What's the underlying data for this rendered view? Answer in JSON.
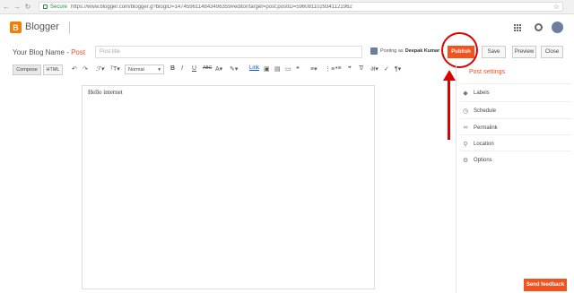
{
  "browser": {
    "secure_label": "Secure",
    "url": "https://www.blogger.com/blogger.g?blogID=1474596114843496359#editor/target=post;postID=5960811029341121962"
  },
  "app": {
    "brand": "Blogger",
    "logo_letter": "B"
  },
  "post": {
    "blog_name": "Your Blog Name",
    "separator": " - ",
    "post_word": "Post",
    "title_placeholder": "Post title",
    "posting_as_label": "Posting as",
    "author": "Deepak Kumar",
    "publish": "Publish",
    "save": "Save",
    "preview": "Preview",
    "close": "Close"
  },
  "toolbar": {
    "compose": "Compose",
    "html": "HTML",
    "font_value": "Normal",
    "link": "Link"
  },
  "editor": {
    "content": "Hello internet"
  },
  "sidebar": {
    "title": "Post settings",
    "items": [
      {
        "label": "Labels",
        "icon": "tag-icon"
      },
      {
        "label": "Schedule",
        "icon": "clock-icon"
      },
      {
        "label": "Permalink",
        "icon": "link-icon"
      },
      {
        "label": "Location",
        "icon": "pin-icon"
      },
      {
        "label": "Options",
        "icon": "gear-icon"
      }
    ]
  },
  "feedback": "Send feedback",
  "colors": {
    "accent": "#f4511e",
    "annotation": "#dd0000"
  }
}
